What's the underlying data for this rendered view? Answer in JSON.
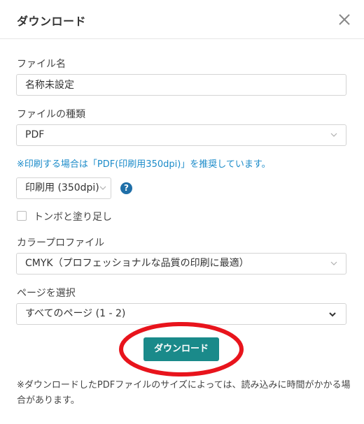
{
  "dialog": {
    "title": "ダウンロード"
  },
  "filename": {
    "label": "ファイル名",
    "value": "名称未設定"
  },
  "file_type": {
    "label": "ファイルの種類",
    "selected": "PDF"
  },
  "recommend_note": "※印刷する場合は「PDF(印刷用350dpi)」を推奨しています。",
  "pdf_quality": {
    "selected": "印刷用 (350dpi)",
    "help_symbol": "?"
  },
  "bleed_option": {
    "label": "トンボと塗り足し",
    "checked": false
  },
  "color_profile": {
    "label": "カラープロファイル",
    "selected": "CMYK（プロフェッショナルな品質の印刷に最適）"
  },
  "pages": {
    "label": "ページを選択",
    "selected": "すべてのページ (1 - 2)"
  },
  "download_button": {
    "label": "ダウンロード"
  },
  "footer_note": "※ダウンロードしたPDFファイルのサイズによっては、読み込みに時間がかかる場合があります。",
  "colors": {
    "accent_button": "#1a8a8a",
    "note_text": "#1b8bc9",
    "help_icon": "#1f6fa8",
    "annotation": "#e8141c"
  },
  "icons": {
    "close": "close-icon",
    "dropdown": "chevron-down-icon",
    "help": "question-circle-icon"
  }
}
